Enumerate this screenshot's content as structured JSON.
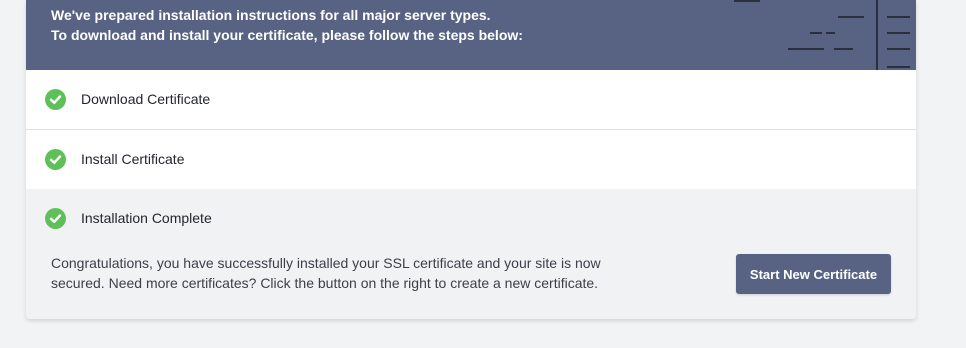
{
  "banner": {
    "line1": "We've prepared installation instructions for all major server types.",
    "line2": "To download and install your certificate, please follow the steps below:"
  },
  "steps": [
    {
      "label": "Download Certificate",
      "status": "complete",
      "icon": "check-circle-icon"
    },
    {
      "label": "Install Certificate",
      "status": "complete",
      "icon": "check-circle-icon"
    },
    {
      "label": "Installation Complete",
      "status": "complete",
      "icon": "check-circle-icon"
    }
  ],
  "completion": {
    "message_line1": "Congratulations, you have successfully installed your SSL certificate and your site is now",
    "message_line2": "secured. Need more certificates? Click the button on the right to create a new certificate.",
    "button_label": "Start New Certificate"
  },
  "colors": {
    "banner": "#586383",
    "success": "#5fc05a",
    "button": "#586383"
  }
}
